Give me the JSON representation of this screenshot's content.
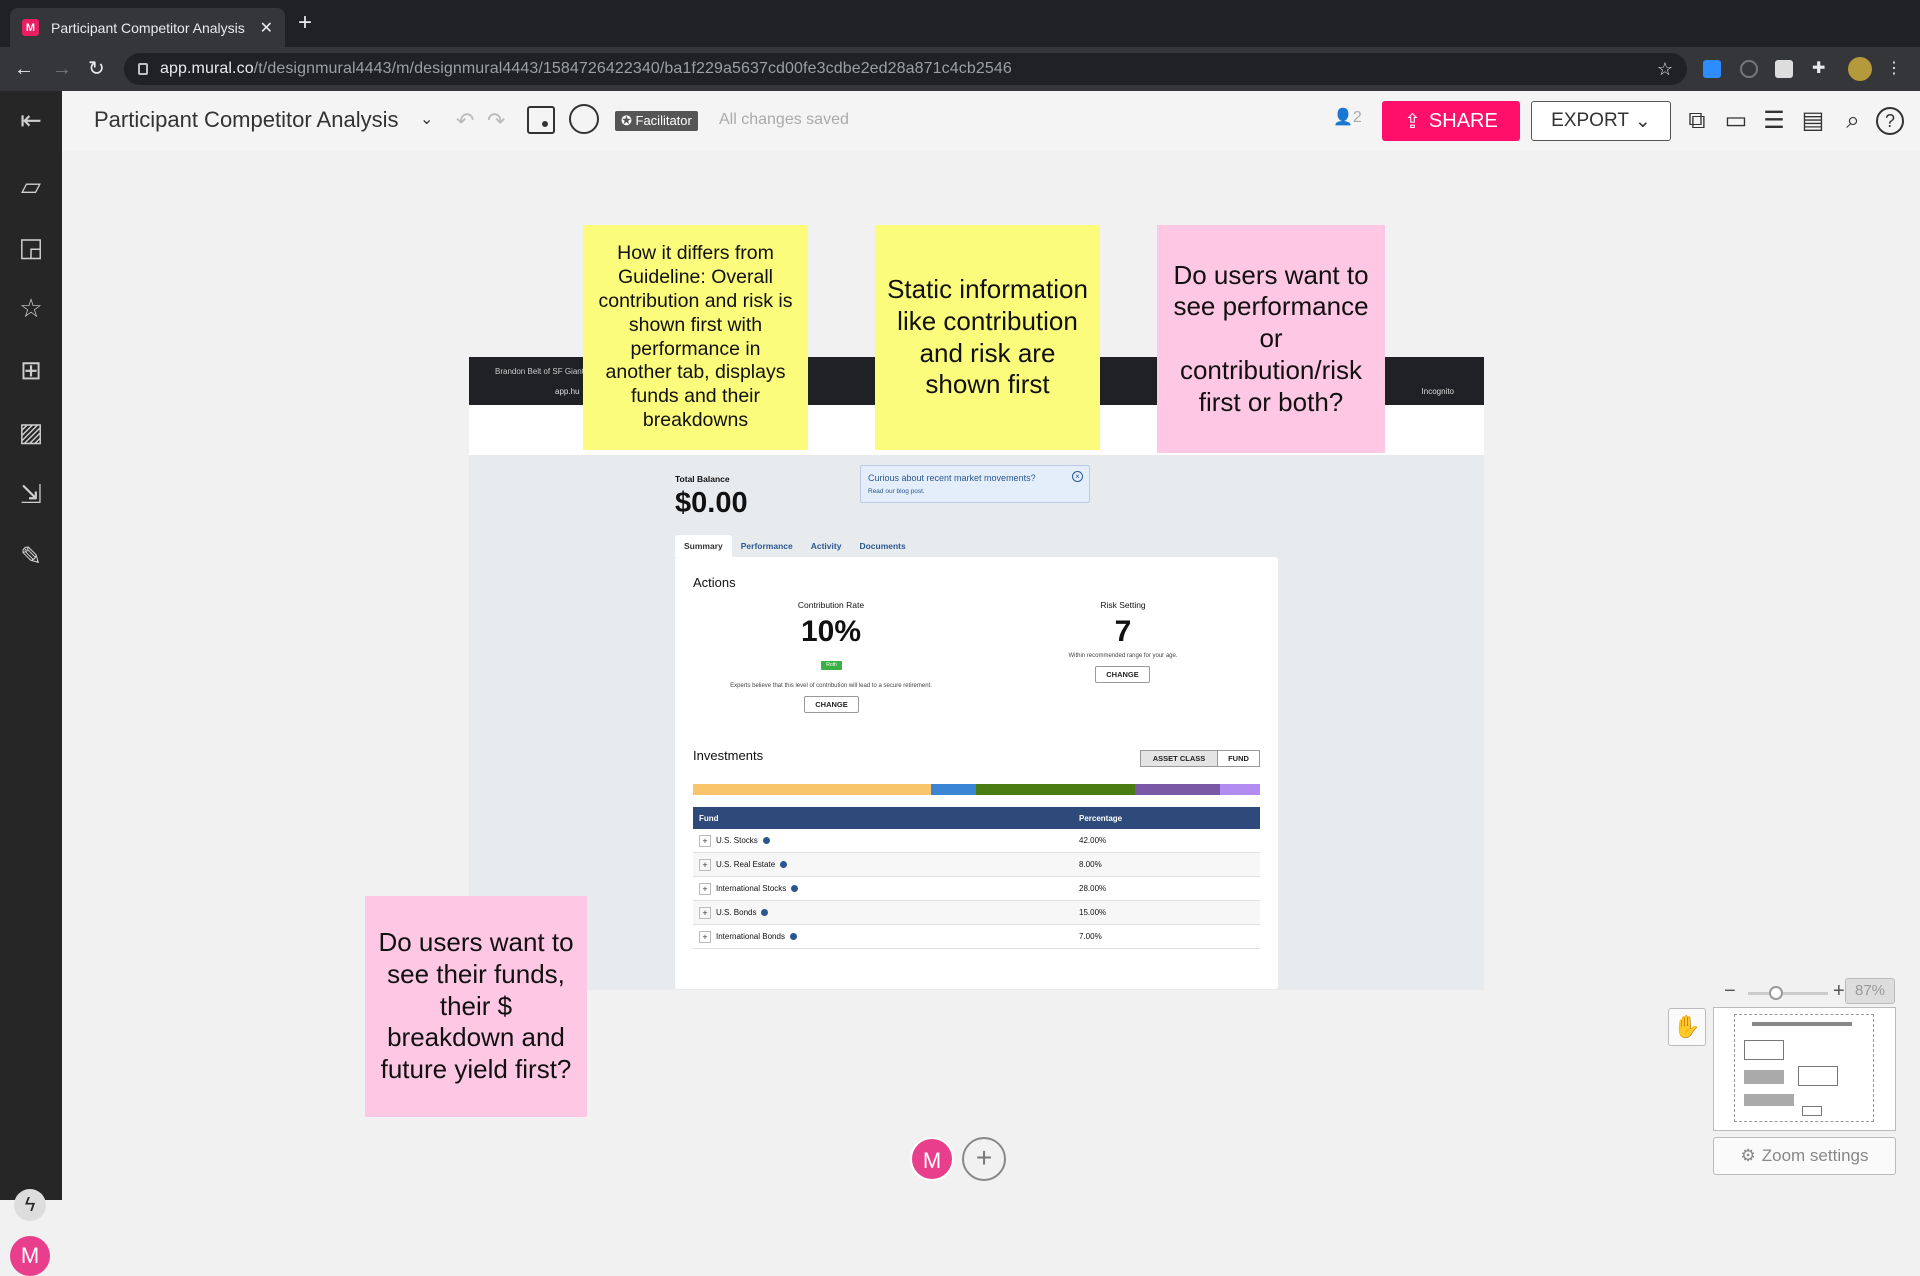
{
  "browser": {
    "tab_title": "Participant Competitor Analysis",
    "tab_close": "✕",
    "new_tab": "+",
    "url_domain": "app.mural.co",
    "url_path": "/t/designmural4443/m/designmural4443/1584726422340/ba1f229a5637cd00fe3cdbe2ed28a871c4cb2546"
  },
  "app": {
    "board_title": "Participant Competitor Analysis",
    "facilitator_badge": "✪ Facilitator",
    "save_status": "All changes saved",
    "participant_count": "2",
    "share_label": "SHARE",
    "export_label": "EXPORT",
    "zoom_level": "87%",
    "zoom_settings_label": "Zoom settings",
    "avatar_initial": "M",
    "brand_color": "#ff0f69"
  },
  "embedded_screenshot": {
    "tab_text": "Brandon Belt of SF Giants",
    "url_text": "app.hu",
    "incognito_label": "Incognito",
    "total_balance_label": "Total Balance",
    "total_balance_value": "$0.00",
    "notice_title": "Curious about recent market movements?",
    "notice_sub": "Read our blog post.",
    "tabs": [
      "Summary",
      "Performance",
      "Activity",
      "Documents"
    ],
    "actions_heading": "Actions",
    "contribution_label": "Contribution Rate",
    "contribution_value": "10%",
    "roth_badge": "Roth",
    "contribution_note": "Experts believe that this level of contribution will lead to a secure retirement.",
    "risk_label": "Risk Setting",
    "risk_value": "7",
    "risk_note": "Within recommended range for your age.",
    "change_label": "CHANGE",
    "investments_heading": "Investments",
    "toggle_asset": "ASSET CLASS",
    "toggle_fund": "FUND",
    "allocation_colors": [
      "#f9c56a",
      "#3a86d4",
      "#4a7a12",
      "#7b58a6",
      "#b28cf0"
    ],
    "allocation_shares": [
      42,
      8,
      28,
      15,
      7
    ],
    "table_headers": [
      "Fund",
      "Percentage"
    ],
    "table_rows": [
      {
        "fund": "U.S. Stocks",
        "pct": "42.00%"
      },
      {
        "fund": "U.S. Real Estate",
        "pct": "8.00%"
      },
      {
        "fund": "International Stocks",
        "pct": "28.00%"
      },
      {
        "fund": "U.S. Bonds",
        "pct": "15.00%"
      },
      {
        "fund": "International Bonds",
        "pct": "7.00%"
      }
    ]
  },
  "stickies": [
    {
      "text": "How it differs from Guideline: Overall contribution and risk is shown first with performance in another tab, displays funds and their breakdowns",
      "color": "#fbfb7c"
    },
    {
      "text": "Static information like contribution and risk are shown first",
      "color": "#fbfb7c"
    },
    {
      "text": "Do users want to see performance or contribution/risk first or both?",
      "color": "#fec8e4"
    },
    {
      "text": "Do users want to see their funds, their $ breakdown and future yield first?",
      "color": "#fec8e4"
    }
  ]
}
